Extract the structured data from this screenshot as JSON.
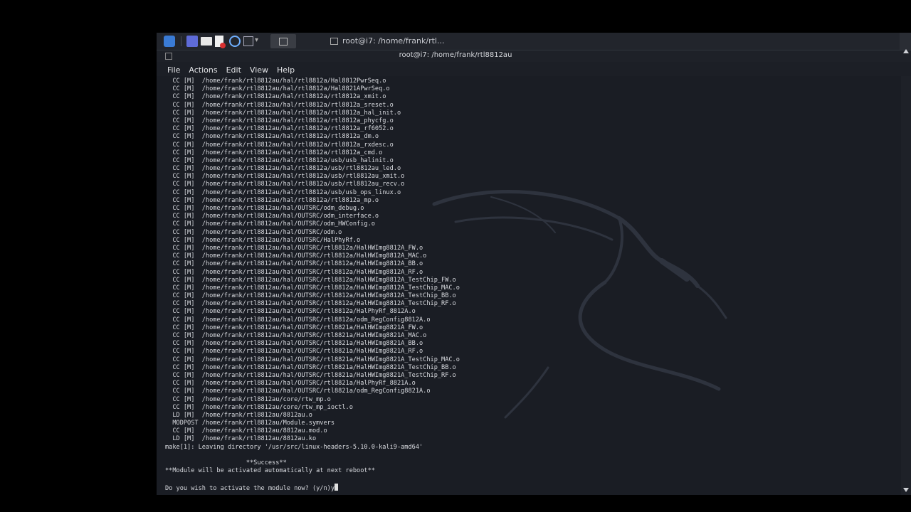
{
  "taskbar": {
    "task_title": "root@i7: /home/frank/rtl..."
  },
  "window": {
    "title": "root@i7: /home/frank/rtl8812au"
  },
  "menu": [
    "File",
    "Actions",
    "Edit",
    "View",
    "Help"
  ],
  "terminal": {
    "lines": [
      "  CC [M]  /home/frank/rtl8812au/hal/rtl8812a/Hal8812PwrSeq.o",
      "  CC [M]  /home/frank/rtl8812au/hal/rtl8812a/Hal8821APwrSeq.o",
      "  CC [M]  /home/frank/rtl8812au/hal/rtl8812a/rtl8812a_xmit.o",
      "  CC [M]  /home/frank/rtl8812au/hal/rtl8812a/rtl8812a_sreset.o",
      "  CC [M]  /home/frank/rtl8812au/hal/rtl8812a/rtl8812a_hal_init.o",
      "  CC [M]  /home/frank/rtl8812au/hal/rtl8812a/rtl8812a_phycfg.o",
      "  CC [M]  /home/frank/rtl8812au/hal/rtl8812a/rtl8812a_rf6052.o",
      "  CC [M]  /home/frank/rtl8812au/hal/rtl8812a/rtl8812a_dm.o",
      "  CC [M]  /home/frank/rtl8812au/hal/rtl8812a/rtl8812a_rxdesc.o",
      "  CC [M]  /home/frank/rtl8812au/hal/rtl8812a/rtl8812a_cmd.o",
      "  CC [M]  /home/frank/rtl8812au/hal/rtl8812a/usb/usb_halinit.o",
      "  CC [M]  /home/frank/rtl8812au/hal/rtl8812a/usb/rtl8812au_led.o",
      "  CC [M]  /home/frank/rtl8812au/hal/rtl8812a/usb/rtl8812au_xmit.o",
      "  CC [M]  /home/frank/rtl8812au/hal/rtl8812a/usb/rtl8812au_recv.o",
      "  CC [M]  /home/frank/rtl8812au/hal/rtl8812a/usb/usb_ops_linux.o",
      "  CC [M]  /home/frank/rtl8812au/hal/rtl8812a/rtl8812a_mp.o",
      "  CC [M]  /home/frank/rtl8812au/hal/OUTSRC/odm_debug.o",
      "  CC [M]  /home/frank/rtl8812au/hal/OUTSRC/odm_interface.o",
      "  CC [M]  /home/frank/rtl8812au/hal/OUTSRC/odm_HWConfig.o",
      "  CC [M]  /home/frank/rtl8812au/hal/OUTSRC/odm.o",
      "  CC [M]  /home/frank/rtl8812au/hal/OUTSRC/HalPhyRf.o",
      "  CC [M]  /home/frank/rtl8812au/hal/OUTSRC/rtl8812a/HalHWImg8812A_FW.o",
      "  CC [M]  /home/frank/rtl8812au/hal/OUTSRC/rtl8812a/HalHWImg8812A_MAC.o",
      "  CC [M]  /home/frank/rtl8812au/hal/OUTSRC/rtl8812a/HalHWImg8812A_BB.o",
      "  CC [M]  /home/frank/rtl8812au/hal/OUTSRC/rtl8812a/HalHWImg8812A_RF.o",
      "  CC [M]  /home/frank/rtl8812au/hal/OUTSRC/rtl8812a/HalHWImg8812A_TestChip_FW.o",
      "  CC [M]  /home/frank/rtl8812au/hal/OUTSRC/rtl8812a/HalHWImg8812A_TestChip_MAC.o",
      "  CC [M]  /home/frank/rtl8812au/hal/OUTSRC/rtl8812a/HalHWImg8812A_TestChip_BB.o",
      "  CC [M]  /home/frank/rtl8812au/hal/OUTSRC/rtl8812a/HalHWImg8812A_TestChip_RF.o",
      "  CC [M]  /home/frank/rtl8812au/hal/OUTSRC/rtl8812a/HalPhyRf_8812A.o",
      "  CC [M]  /home/frank/rtl8812au/hal/OUTSRC/rtl8812a/odm_RegConfig8812A.o",
      "  CC [M]  /home/frank/rtl8812au/hal/OUTSRC/rtl8821a/HalHWImg8821A_FW.o",
      "  CC [M]  /home/frank/rtl8812au/hal/OUTSRC/rtl8821a/HalHWImg8821A_MAC.o",
      "  CC [M]  /home/frank/rtl8812au/hal/OUTSRC/rtl8821a/HalHWImg8821A_BB.o",
      "  CC [M]  /home/frank/rtl8812au/hal/OUTSRC/rtl8821a/HalHWImg8821A_RF.o",
      "  CC [M]  /home/frank/rtl8812au/hal/OUTSRC/rtl8821a/HalHWImg8821A_TestChip_MAC.o",
      "  CC [M]  /home/frank/rtl8812au/hal/OUTSRC/rtl8821a/HalHWImg8821A_TestChip_BB.o",
      "  CC [M]  /home/frank/rtl8812au/hal/OUTSRC/rtl8821a/HalHWImg8821A_TestChip_RF.o",
      "  CC [M]  /home/frank/rtl8812au/hal/OUTSRC/rtl8821a/HalPhyRf_8821A.o",
      "  CC [M]  /home/frank/rtl8812au/hal/OUTSRC/rtl8821a/odm_RegConfig8821A.o",
      "  CC [M]  /home/frank/rtl8812au/core/rtw_mp.o",
      "  CC [M]  /home/frank/rtl8812au/core/rtw_mp_ioctl.o",
      "  LD [M]  /home/frank/rtl8812au/8812au.o",
      "  MODPOST /home/frank/rtl8812au/Module.symvers",
      "  CC [M]  /home/frank/rtl8812au/8812au.mod.o",
      "  LD [M]  /home/frank/rtl8812au/8812au.ko",
      "make[1]: Leaving directory '/usr/src/linux-headers-5.10.0-kali9-amd64'",
      "",
      "                      **Success**",
      "**Module will be activated automatically at next reboot**",
      "",
      "Do you wish to activate the module now? (y/n)y"
    ]
  }
}
